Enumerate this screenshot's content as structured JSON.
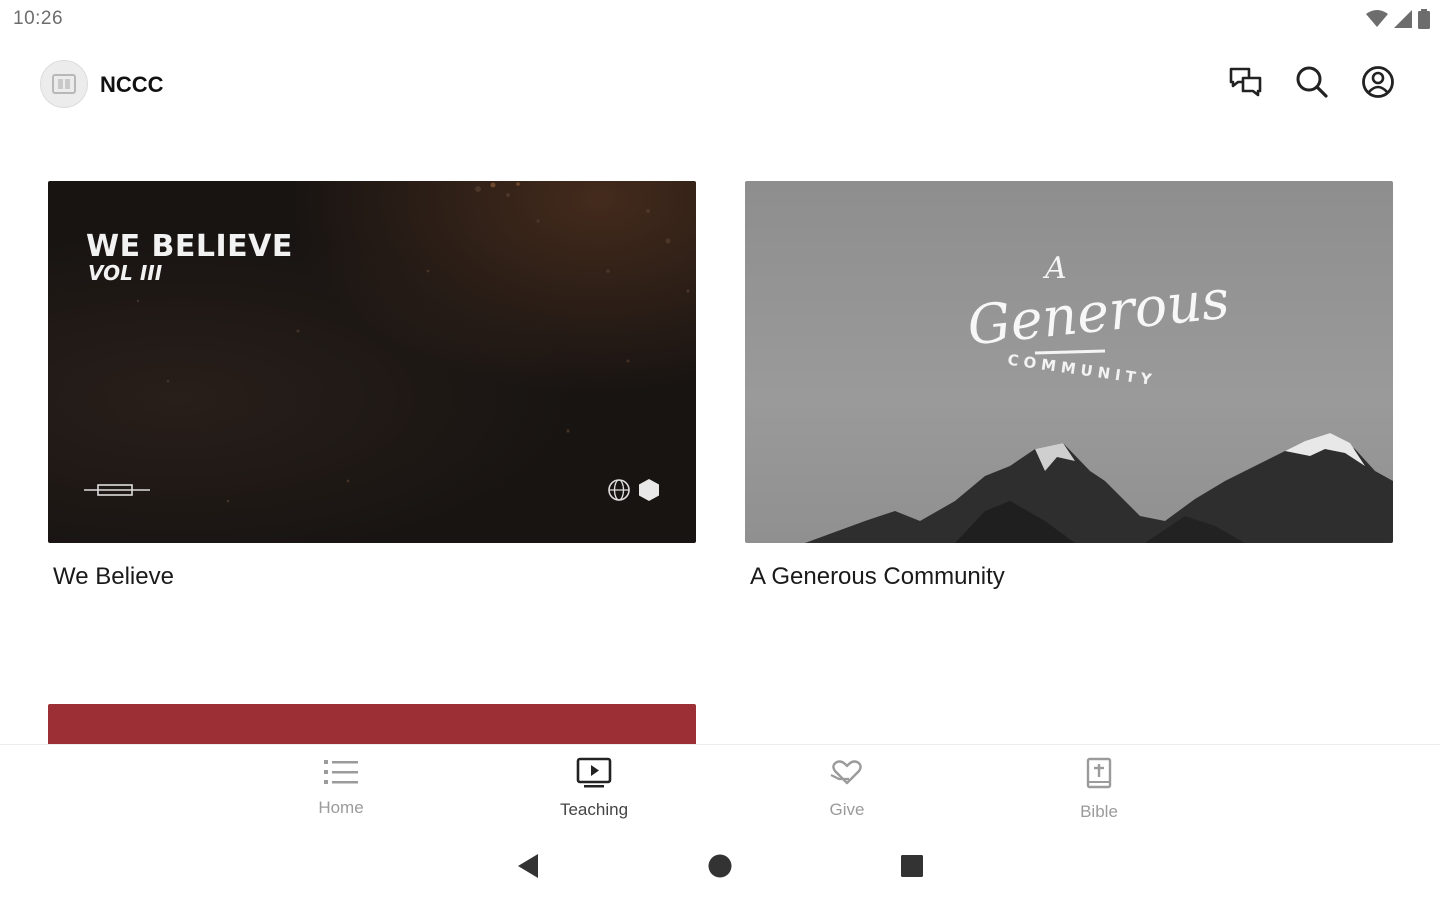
{
  "status_bar": {
    "time": "10:26",
    "icons": [
      "wifi-icon",
      "cell-signal-icon",
      "battery-icon"
    ]
  },
  "app_bar": {
    "title": "NCCC",
    "actions": [
      "chat-icon",
      "search-icon",
      "account-icon"
    ]
  },
  "cards": [
    {
      "title": "We Believe",
      "thumbnail": {
        "headline": "WE BELIEVE",
        "subline": "VOL III"
      }
    },
    {
      "title": "A Generous Community",
      "thumbnail": {
        "script_a": "A",
        "script_word": "Generous",
        "arc_text": "COMMUNITY"
      }
    }
  ],
  "partial_card_color": "#9c2f35",
  "bottom_nav": {
    "items": [
      {
        "label": "Home",
        "icon": "list-icon"
      },
      {
        "label": "Teaching",
        "icon": "tv-play-icon",
        "active": true
      },
      {
        "label": "Give",
        "icon": "give-heart-icon"
      },
      {
        "label": "Bible",
        "icon": "bible-icon"
      }
    ]
  },
  "system_nav": [
    "back-icon",
    "home-icon",
    "recents-icon"
  ]
}
